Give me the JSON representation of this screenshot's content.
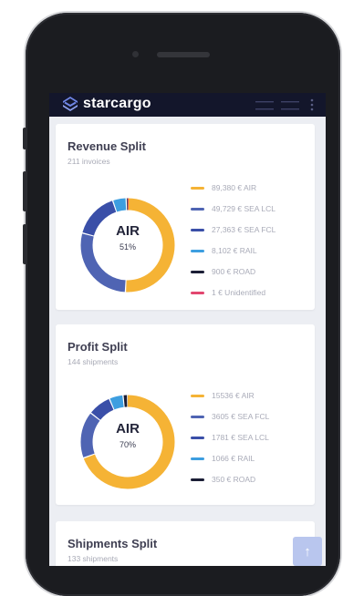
{
  "header": {
    "brand": "starcargo",
    "accent": "#ffffff",
    "background": "#13162b",
    "menu_icons": [
      "menu-icon",
      "menu-icon",
      "more-vertical-icon"
    ]
  },
  "revenue_split": {
    "title": "Revenue Split",
    "subtitle": "211 invoices",
    "center_label": "AIR",
    "center_value": "51%",
    "legend": [
      {
        "text": "89,380 € AIR",
        "color": "#f5b335",
        "value": 89380
      },
      {
        "text": "49,729 € SEA LCL",
        "color": "#4f64b3",
        "value": 49729
      },
      {
        "text": "27,363 € SEA FCL",
        "color": "#3a4fa8",
        "value": 27363
      },
      {
        "text": "8,102 € RAIL",
        "color": "#3d9ee0",
        "value": 8102
      },
      {
        "text": "900 € ROAD",
        "color": "#1b1e36",
        "value": 900
      },
      {
        "text": "1 € Unidentified",
        "color": "#e2466f",
        "value": 1
      }
    ]
  },
  "profit_split": {
    "title": "Profit Split",
    "subtitle": "144 shipments",
    "center_label": "AIR",
    "center_value": "70%",
    "legend": [
      {
        "text": "15536 € AIR",
        "color": "#f5b335",
        "value": 15536
      },
      {
        "text": "3605 € SEA FCL",
        "color": "#4f64b3",
        "value": 3605
      },
      {
        "text": "1781 € SEA LCL",
        "color": "#3a4fa8",
        "value": 1781
      },
      {
        "text": "1066 € RAIL",
        "color": "#3d9ee0",
        "value": 1066
      },
      {
        "text": "350 € ROAD",
        "color": "#1b1e36",
        "value": 350
      }
    ]
  },
  "shipments_split": {
    "title": "Shipments Split",
    "subtitle": "133 shipments"
  },
  "scroll_top": {
    "icon": "arrow-up-icon",
    "glyph": "↑"
  }
}
